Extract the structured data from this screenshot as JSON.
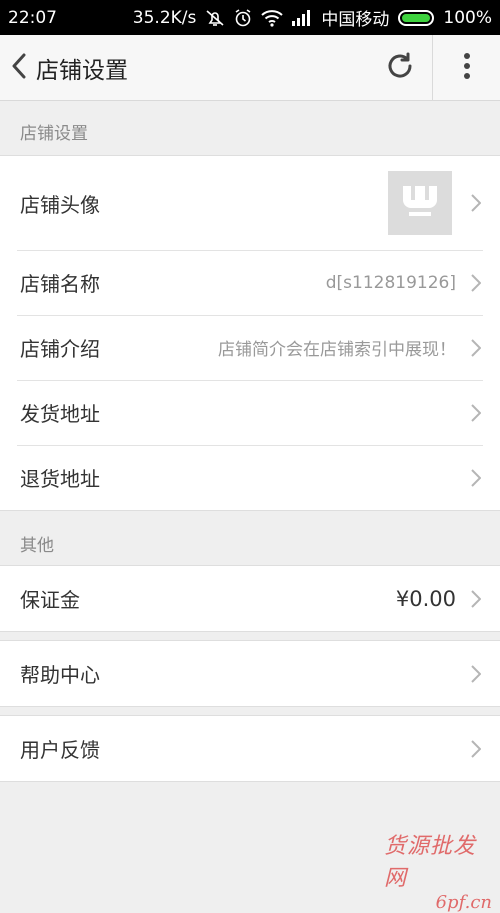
{
  "status_bar": {
    "time": "22:07",
    "speed": "35.2K/s",
    "carrier": "中国移动",
    "battery": "100%",
    "battery_level": 1.0,
    "icons": [
      "mute-icon",
      "alarm-icon",
      "wifi-icon",
      "signal-icon",
      "battery-icon"
    ]
  },
  "header": {
    "title": "店铺设置",
    "icons": [
      "back-arrow-icon",
      "refresh-icon",
      "more-vertical-icon"
    ]
  },
  "sections": {
    "shop_settings": "店铺设置",
    "other": "其他"
  },
  "shop_rows": {
    "avatar_label": "店铺头像",
    "name_label": "店铺名称",
    "name_value": "d[s112819126]",
    "intro_label": "店铺介绍",
    "intro_value": "店铺简介会在店铺索引中展现！",
    "shipping_label": "发货地址",
    "return_label": "退货地址"
  },
  "other_rows": {
    "deposit_label": "保证金",
    "deposit_value": "¥0.00",
    "help_label": "帮助中心",
    "feedback_label": "用户反馈"
  },
  "watermark": {
    "line1": "货源批发网",
    "line2": "6pf.cn"
  },
  "colors": {
    "status_bar_bg": "#000000",
    "battery_green": "#3ed23e",
    "page_bg": "#efefef",
    "watermark_red": "#e06a6a"
  }
}
